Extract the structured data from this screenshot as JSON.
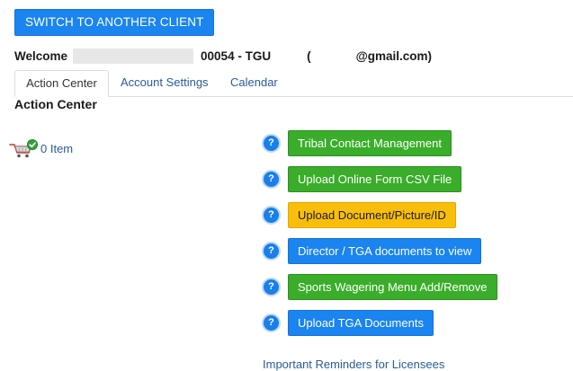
{
  "header": {
    "switch_button_label": "SWITCH TO ANOTHER CLIENT",
    "welcome_label": "Welcome",
    "client_code": "00054 - TGU",
    "email_open_paren": "(",
    "email_domain": "@gmail.com)"
  },
  "tabs": [
    {
      "label": "Action Center",
      "active": true
    },
    {
      "label": "Account Settings",
      "active": false
    },
    {
      "label": "Calendar",
      "active": false
    }
  ],
  "page_title": "Action Center",
  "cart": {
    "count_label": "0 Item"
  },
  "actions": [
    {
      "label": "Tribal Contact Management",
      "color": "green"
    },
    {
      "label": "Upload Online Form CSV File",
      "color": "green"
    },
    {
      "label": "Upload Document/Picture/ID",
      "color": "yellow"
    },
    {
      "label": "Director / TGA documents to view",
      "color": "blue"
    },
    {
      "label": "Sports Wagering Menu Add/Remove",
      "color": "green"
    },
    {
      "label": "Upload TGA Documents",
      "color": "blue"
    }
  ],
  "help_icon_glyph": "?",
  "reminders_link": "Important Reminders for Licensees",
  "colors": {
    "primary_blue": "#1a84f0",
    "green": "#3aad2a",
    "yellow": "#f9be0a",
    "link": "#2a5c9a"
  }
}
